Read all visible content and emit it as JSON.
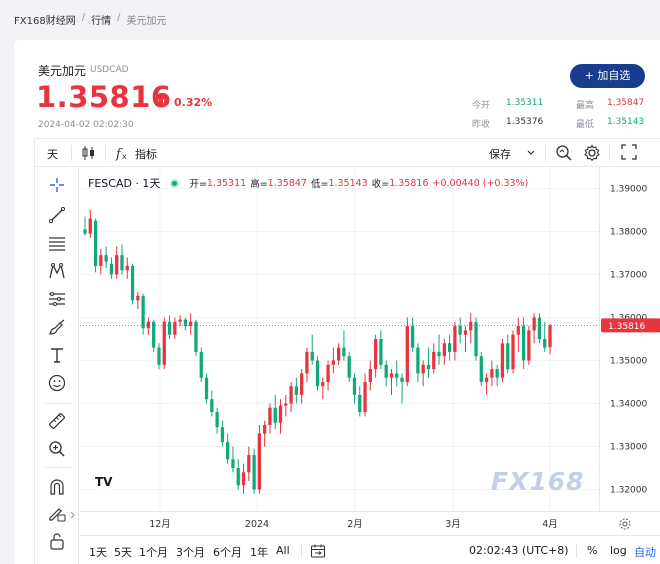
{
  "breadcrumb": [
    "FX168财经网",
    "行情",
    "美元加元"
  ],
  "quote": {
    "name": "美元加元",
    "code": "USDCAD",
    "price": "1.35816",
    "change_pct": "0.32%",
    "timestamp": "2024-04-02 02:02:30",
    "add_button": "+ 加自选",
    "stats": [
      {
        "label": "今开",
        "value": "1.35311",
        "color": "green"
      },
      {
        "label": "最高",
        "value": "1.35847",
        "color": "red"
      },
      {
        "label": "昨收",
        "value": "1.35376",
        "color": "dark"
      },
      {
        "label": "最低",
        "value": "1.35143",
        "color": "green"
      }
    ]
  },
  "toolbar": {
    "interval": "天",
    "indicators": "指标",
    "save": "保存"
  },
  "legend": {
    "symbol": "FESCAD · 1天",
    "open_label": "开=",
    "open": "1.35311",
    "high_label": "高=",
    "high": "1.35847",
    "low_label": "低=",
    "low": "1.35143",
    "close_label": "收=",
    "close": "1.35816",
    "change": "+0.00440 (+0.33%)"
  },
  "price_axis": {
    "ticks": [
      "1.39000",
      "1.38000",
      "1.37000",
      "1.36000",
      "1.35000",
      "1.34000",
      "1.33000",
      "1.32000"
    ],
    "current": "1.35816"
  },
  "time_axis": {
    "ticks": [
      "12月",
      "2024",
      "2月",
      "3月",
      "4月"
    ]
  },
  "ranges": [
    "1天",
    "5天",
    "1个月",
    "3个月",
    "6个月",
    "1年",
    "All"
  ],
  "bottom_right": {
    "time": "02:02:43 (UTC+8)",
    "percent": "%",
    "log": "log",
    "auto": "自动"
  },
  "watermark": "FX168",
  "colors": {
    "up": "#e8343f",
    "down": "#11a87a",
    "brand": "#1a3c8f"
  },
  "chart_data": {
    "type": "candlestick",
    "symbol": "FESCAD",
    "interval": "1天",
    "ylim": [
      1.315,
      1.395
    ],
    "x_ticks": [
      "12月",
      "2024",
      "2月",
      "3月",
      "4月"
    ],
    "candles": [
      [
        1.3805,
        1.3835,
        1.379,
        1.3795
      ],
      [
        1.3795,
        1.385,
        1.3785,
        1.383
      ],
      [
        1.3825,
        1.383,
        1.3705,
        1.372
      ],
      [
        1.372,
        1.376,
        1.37,
        1.3745
      ],
      [
        1.3745,
        1.3765,
        1.3715,
        1.373
      ],
      [
        1.3725,
        1.374,
        1.369,
        1.37
      ],
      [
        1.37,
        1.3765,
        1.369,
        1.3745
      ],
      [
        1.3745,
        1.377,
        1.37,
        1.371
      ],
      [
        1.371,
        1.374,
        1.369,
        1.372
      ],
      [
        1.372,
        1.3725,
        1.363,
        1.364
      ],
      [
        1.364,
        1.366,
        1.362,
        1.365
      ],
      [
        1.365,
        1.3655,
        1.356,
        1.3575
      ],
      [
        1.3575,
        1.36,
        1.356,
        1.359
      ],
      [
        1.359,
        1.3595,
        1.352,
        1.353
      ],
      [
        1.353,
        1.354,
        1.348,
        1.349
      ],
      [
        1.349,
        1.36,
        1.348,
        1.359
      ],
      [
        1.359,
        1.3605,
        1.355,
        1.356
      ],
      [
        1.356,
        1.36,
        1.355,
        1.359
      ],
      [
        1.359,
        1.3605,
        1.358,
        1.3595
      ],
      [
        1.3595,
        1.36,
        1.357,
        1.358
      ],
      [
        1.358,
        1.361,
        1.356,
        1.359
      ],
      [
        1.359,
        1.3595,
        1.351,
        1.352
      ],
      [
        1.352,
        1.353,
        1.345,
        1.346
      ],
      [
        1.346,
        1.347,
        1.34,
        1.341
      ],
      [
        1.341,
        1.343,
        1.337,
        1.338
      ],
      [
        1.338,
        1.339,
        1.333,
        1.3345
      ],
      [
        1.3345,
        1.336,
        1.33,
        1.331
      ],
      [
        1.331,
        1.333,
        1.326,
        1.327
      ],
      [
        1.327,
        1.33,
        1.324,
        1.325
      ],
      [
        1.325,
        1.327,
        1.32,
        1.321
      ],
      [
        1.321,
        1.326,
        1.319,
        1.324
      ],
      [
        1.324,
        1.33,
        1.322,
        1.328
      ],
      [
        1.328,
        1.3295,
        1.319,
        1.32
      ],
      [
        1.32,
        1.335,
        1.319,
        1.333
      ],
      [
        1.333,
        1.336,
        1.33,
        1.335
      ],
      [
        1.335,
        1.34,
        1.333,
        1.339
      ],
      [
        1.339,
        1.342,
        1.334,
        1.3355
      ],
      [
        1.3355,
        1.341,
        1.333,
        1.3395
      ],
      [
        1.3395,
        1.342,
        1.337,
        1.34
      ],
      [
        1.34,
        1.345,
        1.338,
        1.344
      ],
      [
        1.344,
        1.346,
        1.34,
        1.342
      ],
      [
        1.342,
        1.348,
        1.34,
        1.347
      ],
      [
        1.347,
        1.353,
        1.345,
        1.352
      ],
      [
        1.352,
        1.356,
        1.349,
        1.35
      ],
      [
        1.35,
        1.351,
        1.343,
        1.344
      ],
      [
        1.344,
        1.346,
        1.341,
        1.345
      ],
      [
        1.345,
        1.35,
        1.343,
        1.349
      ],
      [
        1.349,
        1.353,
        1.347,
        1.35
      ],
      [
        1.35,
        1.354,
        1.349,
        1.353
      ],
      [
        1.353,
        1.357,
        1.35,
        1.351
      ],
      [
        1.351,
        1.352,
        1.345,
        1.346
      ],
      [
        1.346,
        1.347,
        1.34,
        1.342
      ],
      [
        1.342,
        1.344,
        1.337,
        1.338
      ],
      [
        1.338,
        1.347,
        1.337,
        1.345
      ],
      [
        1.345,
        1.35,
        1.343,
        1.348
      ],
      [
        1.348,
        1.356,
        1.346,
        1.355
      ],
      [
        1.355,
        1.357,
        1.348,
        1.349
      ],
      [
        1.349,
        1.35,
        1.344,
        1.346
      ],
      [
        1.346,
        1.348,
        1.342,
        1.347
      ],
      [
        1.347,
        1.35,
        1.344,
        1.346
      ],
      [
        1.346,
        1.347,
        1.34,
        1.345
      ],
      [
        1.345,
        1.36,
        1.344,
        1.358
      ],
      [
        1.358,
        1.36,
        1.352,
        1.353
      ],
      [
        1.353,
        1.354,
        1.345,
        1.347
      ],
      [
        1.347,
        1.35,
        1.344,
        1.349
      ],
      [
        1.349,
        1.353,
        1.346,
        1.348
      ],
      [
        1.348,
        1.354,
        1.347,
        1.352
      ],
      [
        1.352,
        1.356,
        1.349,
        1.351
      ],
      [
        1.351,
        1.355,
        1.349,
        1.354
      ],
      [
        1.354,
        1.356,
        1.35,
        1.352
      ],
      [
        1.352,
        1.359,
        1.35,
        1.358
      ],
      [
        1.358,
        1.36,
        1.354,
        1.356
      ],
      [
        1.356,
        1.358,
        1.352,
        1.357
      ],
      [
        1.357,
        1.361,
        1.354,
        1.359
      ],
      [
        1.359,
        1.36,
        1.35,
        1.351
      ],
      [
        1.351,
        1.352,
        1.344,
        1.345
      ],
      [
        1.345,
        1.347,
        1.342,
        1.346
      ],
      [
        1.346,
        1.35,
        1.344,
        1.348
      ],
      [
        1.348,
        1.349,
        1.344,
        1.346
      ],
      [
        1.346,
        1.355,
        1.345,
        1.354
      ],
      [
        1.354,
        1.356,
        1.347,
        1.348
      ],
      [
        1.348,
        1.357,
        1.347,
        1.356
      ],
      [
        1.356,
        1.36,
        1.352,
        1.358
      ],
      [
        1.358,
        1.36,
        1.348,
        1.35
      ],
      [
        1.35,
        1.358,
        1.349,
        1.357
      ],
      [
        1.357,
        1.361,
        1.354,
        1.36
      ],
      [
        1.36,
        1.361,
        1.354,
        1.355
      ],
      [
        1.355,
        1.359,
        1.352,
        1.353
      ],
      [
        1.3531,
        1.3585,
        1.3514,
        1.3582
      ]
    ]
  }
}
